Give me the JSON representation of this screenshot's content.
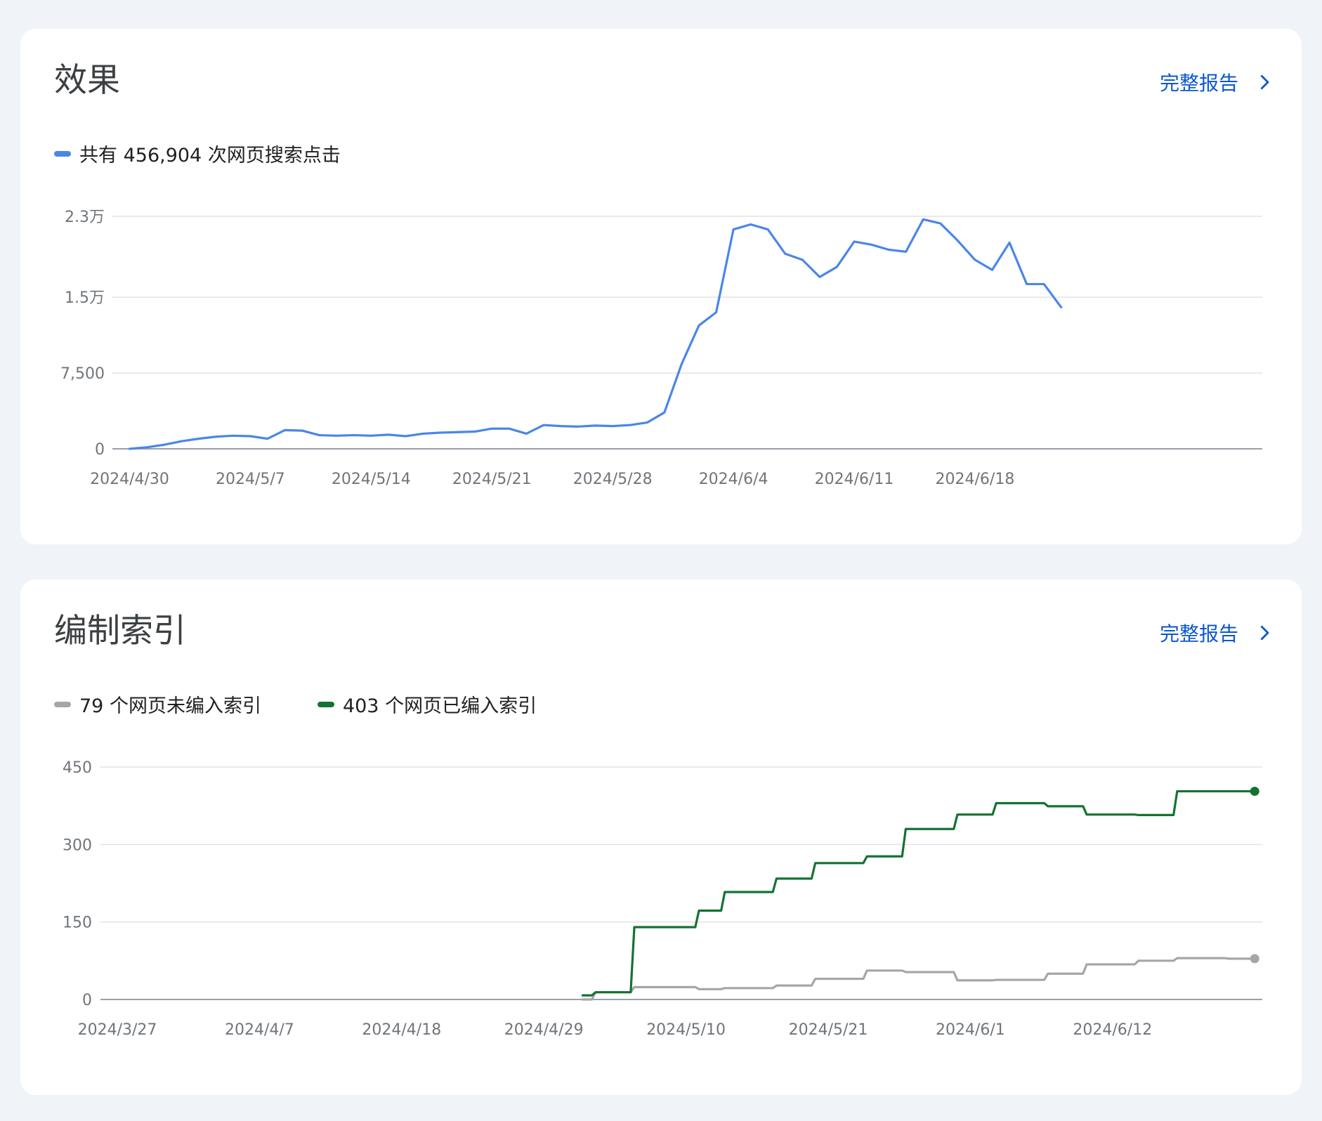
{
  "performance": {
    "title": "效果",
    "full_report_label": "完整报告",
    "legend": [
      {
        "label": "共有 456,904 次网页搜索点击",
        "color": "#4a86e8"
      }
    ]
  },
  "indexing": {
    "title": "编制索引",
    "full_report_label": "完整报告",
    "legend": [
      {
        "label": "79 个网页未编入索引",
        "color": "#a6a6a6"
      },
      {
        "label": "403 个网页已编入索引",
        "color": "#137333"
      }
    ]
  },
  "chart_data": [
    {
      "type": "line",
      "title": "",
      "xlabel": "",
      "ylabel": "",
      "x_start": "2024/4/30",
      "x_tick_labels": [
        "2024/4/30",
        "2024/5/7",
        "2024/5/14",
        "2024/5/21",
        "2024/5/28",
        "2024/6/4",
        "2024/6/11",
        "2024/6/18"
      ],
      "y_tick_values": [
        0,
        7500,
        15000,
        23000
      ],
      "y_tick_labels": [
        "0",
        "7,500",
        "1.5万",
        "2.3万"
      ],
      "ylim": [
        0,
        23000
      ],
      "grid": true,
      "legend_position": "top-left",
      "series": [
        {
          "name": "共有 456,904 次网页搜索点击",
          "color": "#4a86e8",
          "x": [
            "2024/4/30",
            "2024/5/1",
            "2024/5/2",
            "2024/5/3",
            "2024/5/4",
            "2024/5/5",
            "2024/5/6",
            "2024/5/7",
            "2024/5/8",
            "2024/5/9",
            "2024/5/10",
            "2024/5/11",
            "2024/5/12",
            "2024/5/13",
            "2024/5/14",
            "2024/5/15",
            "2024/5/16",
            "2024/5/17",
            "2024/5/18",
            "2024/5/19",
            "2024/5/20",
            "2024/5/21",
            "2024/5/22",
            "2024/5/23",
            "2024/5/24",
            "2024/5/25",
            "2024/5/26",
            "2024/5/27",
            "2024/5/28",
            "2024/5/29",
            "2024/5/30",
            "2024/5/31",
            "2024/6/1",
            "2024/6/2",
            "2024/6/3",
            "2024/6/4",
            "2024/6/5",
            "2024/6/6",
            "2024/6/7",
            "2024/6/8",
            "2024/6/9",
            "2024/6/10",
            "2024/6/11",
            "2024/6/12",
            "2024/6/13",
            "2024/6/14",
            "2024/6/15",
            "2024/6/16",
            "2024/6/17",
            "2024/6/18",
            "2024/6/19",
            "2024/6/20",
            "2024/6/21",
            "2024/6/22",
            "2024/6/23"
          ],
          "values": [
            0,
            150,
            400,
            750,
            1000,
            1200,
            1300,
            1250,
            1000,
            1850,
            1800,
            1350,
            1300,
            1350,
            1300,
            1400,
            1250,
            1500,
            1600,
            1650,
            1700,
            2000,
            2000,
            1500,
            2350,
            2250,
            2200,
            2300,
            2250,
            2350,
            2600,
            3600,
            8400,
            12200,
            13500,
            21700,
            22200,
            21700,
            19300,
            18700,
            17000,
            18000,
            20500,
            20200,
            19700,
            19500,
            22700,
            22300,
            20600,
            18700,
            17700,
            20400,
            16300,
            16300,
            14000
          ]
        }
      ]
    },
    {
      "type": "line",
      "title": "",
      "xlabel": "",
      "ylabel": "",
      "x_start": "2024/3/27",
      "x_tick_labels": [
        "2024/3/27",
        "2024/4/7",
        "2024/4/18",
        "2024/4/29",
        "2024/5/10",
        "2024/5/21",
        "2024/6/1",
        "2024/6/12"
      ],
      "y_tick_values": [
        0,
        150,
        300,
        450
      ],
      "y_tick_labels": [
        "0",
        "150",
        "300",
        "450"
      ],
      "ylim": [
        0,
        450
      ],
      "grid": true,
      "legend_position": "top-left",
      "series": [
        {
          "name": "79 个网页未编入索引",
          "color": "#a6a6a6",
          "step": true,
          "x": [
            "2024/5/2",
            "2024/5/3",
            "2024/5/4",
            "2024/5/5",
            "2024/5/6",
            "2024/5/7",
            "2024/5/8",
            "2024/5/9",
            "2024/5/10",
            "2024/5/11",
            "2024/5/12",
            "2024/5/13",
            "2024/5/14",
            "2024/5/15",
            "2024/5/16",
            "2024/5/17",
            "2024/5/18",
            "2024/5/19",
            "2024/5/20",
            "2024/5/21",
            "2024/5/22",
            "2024/5/23",
            "2024/5/24",
            "2024/5/25",
            "2024/5/26",
            "2024/5/27",
            "2024/5/28",
            "2024/5/29",
            "2024/5/30",
            "2024/5/31",
            "2024/6/1",
            "2024/6/2",
            "2024/6/3",
            "2024/6/4",
            "2024/6/5",
            "2024/6/6",
            "2024/6/7",
            "2024/6/8",
            "2024/6/9",
            "2024/6/10",
            "2024/6/11",
            "2024/6/12",
            "2024/6/13",
            "2024/6/14",
            "2024/6/15",
            "2024/6/16",
            "2024/6/17",
            "2024/6/18",
            "2024/6/19",
            "2024/6/20",
            "2024/6/21",
            "2024/6/22",
            "2024/6/23"
          ],
          "values": [
            0,
            14,
            14,
            14,
            24,
            24,
            24,
            24,
            24,
            20,
            20,
            22,
            22,
            22,
            22,
            27,
            27,
            27,
            40,
            40,
            40,
            40,
            56,
            56,
            56,
            53,
            53,
            53,
            53,
            37,
            37,
            37,
            38,
            38,
            38,
            38,
            50,
            50,
            50,
            68,
            68,
            68,
            68,
            75,
            75,
            75,
            80,
            80,
            80,
            80,
            79,
            79,
            79
          ]
        },
        {
          "name": "403 个网页已编入索引",
          "color": "#137333",
          "step": true,
          "x": [
            "2024/5/2",
            "2024/5/3",
            "2024/5/4",
            "2024/5/5",
            "2024/5/6",
            "2024/5/7",
            "2024/5/8",
            "2024/5/9",
            "2024/5/10",
            "2024/5/11",
            "2024/5/12",
            "2024/5/13",
            "2024/5/14",
            "2024/5/15",
            "2024/5/16",
            "2024/5/17",
            "2024/5/18",
            "2024/5/19",
            "2024/5/20",
            "2024/5/21",
            "2024/5/22",
            "2024/5/23",
            "2024/5/24",
            "2024/5/25",
            "2024/5/26",
            "2024/5/27",
            "2024/5/28",
            "2024/5/29",
            "2024/5/30",
            "2024/5/31",
            "2024/6/1",
            "2024/6/2",
            "2024/6/3",
            "2024/6/4",
            "2024/6/5",
            "2024/6/6",
            "2024/6/7",
            "2024/6/8",
            "2024/6/9",
            "2024/6/10",
            "2024/6/11",
            "2024/6/12",
            "2024/6/13",
            "2024/6/14",
            "2024/6/15",
            "2024/6/16",
            "2024/6/17",
            "2024/6/18",
            "2024/6/19",
            "2024/6/20",
            "2024/6/21",
            "2024/6/22",
            "2024/6/23"
          ],
          "values": [
            8,
            14,
            14,
            14,
            140,
            140,
            140,
            140,
            140,
            172,
            172,
            208,
            208,
            208,
            208,
            234,
            234,
            234,
            264,
            264,
            264,
            264,
            277,
            277,
            277,
            330,
            330,
            330,
            330,
            358,
            358,
            358,
            380,
            380,
            380,
            380,
            374,
            374,
            374,
            358,
            358,
            358,
            358,
            357,
            357,
            357,
            403,
            403,
            403,
            403,
            403,
            403,
            403
          ]
        }
      ]
    }
  ]
}
